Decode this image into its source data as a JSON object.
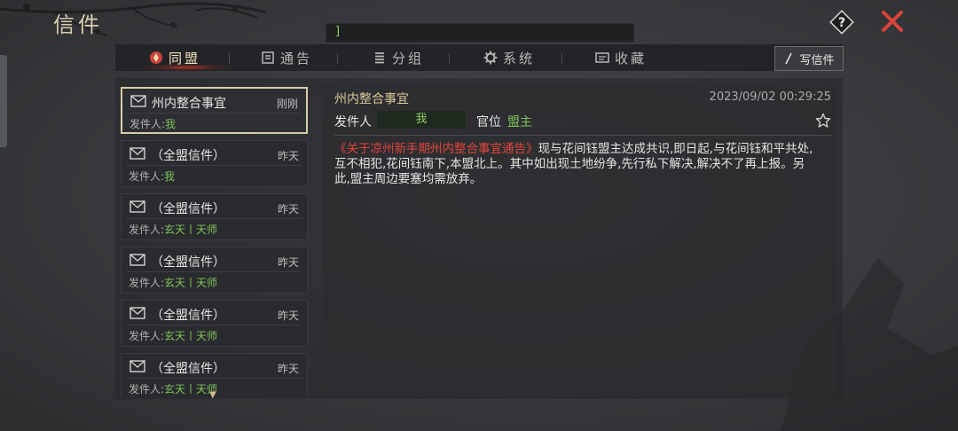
{
  "header": {
    "title": "信件",
    "search_value": "]"
  },
  "tabs": [
    {
      "label": "同盟",
      "icon": "alliance-icon",
      "active": true
    },
    {
      "label": "通告",
      "icon": "notice-icon",
      "active": false
    },
    {
      "label": "分组",
      "icon": "group-icon",
      "active": false
    },
    {
      "label": "系统",
      "icon": "gear-icon",
      "active": false
    },
    {
      "label": "收藏",
      "icon": "collection-icon",
      "active": false
    }
  ],
  "compose_label": "写信件",
  "sender_prefix": "发件人:",
  "mails": [
    {
      "subject": "州内整合事宜",
      "time": "刚刚",
      "sender": "我",
      "selected": true
    },
    {
      "subject": "（全盟信件）",
      "time": "昨天",
      "sender": "我",
      "selected": false
    },
    {
      "subject": "（全盟信件）",
      "time": "昨天",
      "sender": "玄天丨天师",
      "selected": false
    },
    {
      "subject": "（全盟信件）",
      "time": "昨天",
      "sender": "玄天丨天师",
      "selected": false
    },
    {
      "subject": "（全盟信件）",
      "time": "昨天",
      "sender": "玄天丨天师",
      "selected": false
    },
    {
      "subject": "（全盟信件）",
      "time": "昨天",
      "sender": "玄天丨天师",
      "selected": false
    }
  ],
  "detail": {
    "subject": "州内整合事宜",
    "date": "2023/09/02 00:29:25",
    "sender_label": "发件人",
    "sender_name": "我",
    "rank_label": "官位",
    "rank": "盟主",
    "body_highlight": "《关于凉州新手期州内整合事宜通告》",
    "body_text": "现与花间钰盟主达成共识,即日起,与花间钰和平共处,互不相犯,花间钰南下,本盟北上。其中如出现土地纷争,先行私下解决,解决不了再上报。另此,盟主周边要塞均需放弃。"
  },
  "colors": {
    "accent_gold": "#d9cfae",
    "sender_green": "#7fc25c",
    "highlight_red": "#e0443a",
    "close_red": "#d8433b"
  }
}
